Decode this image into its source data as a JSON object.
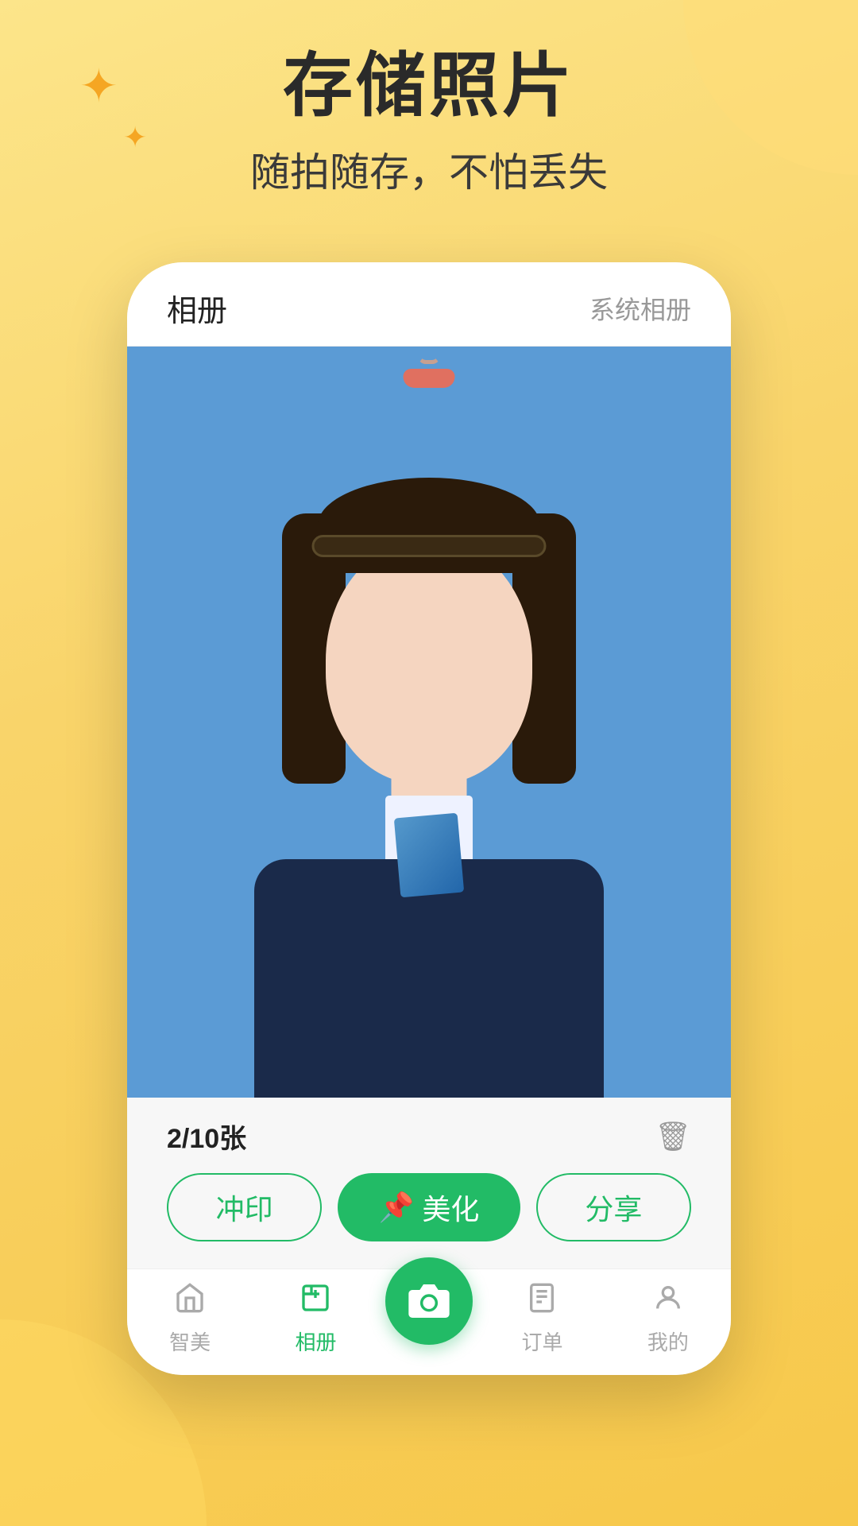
{
  "page": {
    "background_color": "#f9d46a",
    "main_title": "存储照片",
    "sub_title": "随拍随存，不怕丢失"
  },
  "phone": {
    "topbar": {
      "title": "相册",
      "right_label": "系统相册"
    },
    "photo": {
      "count_current": "2",
      "count_total": "10",
      "count_unit": "张",
      "count_display": "2/10张"
    },
    "buttons": {
      "print": "冲印",
      "beautify": "美化",
      "share": "分享",
      "beautify_pin": "📌"
    }
  },
  "nav": {
    "items": [
      {
        "label": "智美",
        "icon": "home",
        "active": false
      },
      {
        "label": "相册",
        "icon": "album",
        "active": true
      },
      {
        "label": "",
        "icon": "camera",
        "active": false,
        "is_center": true
      },
      {
        "label": "订单",
        "icon": "order",
        "active": false
      },
      {
        "label": "我的",
        "icon": "profile",
        "active": false
      }
    ]
  }
}
